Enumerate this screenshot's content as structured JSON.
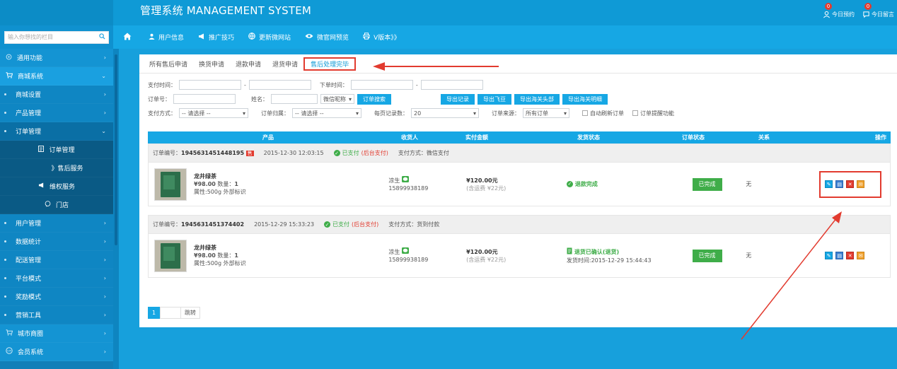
{
  "header": {
    "title": "管理系统 MANAGEMENT SYSTEM",
    "appointments": {
      "label": "今日预约",
      "count": "0",
      "icon": "user-icon"
    },
    "messages": {
      "label": "今日留言",
      "count": "0",
      "icon": "chat-bubble-icon"
    }
  },
  "navbar": {
    "items": [
      {
        "label": "用户信息",
        "icon": "user-icon"
      },
      {
        "label": "推广技巧",
        "icon": "megaphone-icon"
      },
      {
        "label": "更新微网站",
        "icon": "globe-icon"
      },
      {
        "label": "微官网预览",
        "icon": "eye-icon"
      },
      {
        "label": "V版本》》",
        "icon": "printer-icon"
      }
    ]
  },
  "sidebar": {
    "search_placeholder": "输入你想找的栏目",
    "items": [
      {
        "label": "通用功能"
      },
      {
        "label": "商城系统"
      },
      {
        "label": "商城设置"
      },
      {
        "label": "产品管理"
      },
      {
        "label": "订单管理"
      },
      {
        "label": "订单管理"
      },
      {
        "label": "》售后服务"
      },
      {
        "label": "维权服务"
      },
      {
        "label": "门店"
      },
      {
        "label": "用户管理"
      },
      {
        "label": "数据统计"
      },
      {
        "label": "配送管理"
      },
      {
        "label": "平台模式"
      },
      {
        "label": "奖励模式"
      },
      {
        "label": "营销工具"
      },
      {
        "label": "城市商圈"
      },
      {
        "label": "会员系统"
      }
    ]
  },
  "tabs": [
    "所有售后申请",
    "换货申请",
    "退款申请",
    "退货申请",
    "售后处理完毕"
  ],
  "filters": {
    "pay_time_label": "支付时间：",
    "order_time_label": "下单时间：",
    "order_no_label": "订单号：",
    "name_label": "姓名：",
    "nickname_select": "微信昵称",
    "search_btn": "订单搜索",
    "export_buttons": [
      "导出记录",
      "导出飞豆",
      "导出海关头部",
      "导出海关明细"
    ],
    "pay_method_label": "支付方式：",
    "pay_method_value": "-- 请选择 --",
    "order_group_label": "订单归属：",
    "order_group_value": "-- 请选择 --",
    "page_size_label": "每页记录数：",
    "page_size_value": "20",
    "order_source_label": "订单来源：",
    "order_source_value": "所有订单",
    "auto_refresh_label": "自动刷新订单",
    "order_alert_label": "订单提醒功能"
  },
  "table": {
    "columns": [
      "产品",
      "收货人",
      "实付金额",
      "发货状态",
      "订单状态",
      "关系",
      "操作"
    ],
    "orders": [
      {
        "order_no_label": "订单编号：",
        "order_no": "1945631451448195",
        "tag": "售",
        "time": "2015-12-30 12:03:15",
        "paid_text": "已支付",
        "paid_sub": "(后台支付)",
        "pay_method": "支付方式：微信支付",
        "product_name": "龙井绿茶",
        "product_price": "¥98.00",
        "qty_label": "数量：",
        "qty": "1",
        "attr": "属性:500g 外部标识",
        "receiver": "凉生",
        "phone": "15899938189",
        "amount": "¥120.00元",
        "freight": "(含运费 ¥22元)",
        "ship_status": "退款完成",
        "ship_time": "",
        "order_status": "已完成",
        "relation": "无"
      },
      {
        "order_no_label": "订单编号：",
        "order_no": "1945631451374402",
        "tag": "",
        "time": "2015-12-29 15:33:23",
        "paid_text": "已支付",
        "paid_sub": "(后台支付)",
        "pay_method": "支付方式：货到付款",
        "product_name": "龙井绿茶",
        "product_price": "¥98.00",
        "qty_label": "数量：",
        "qty": "1",
        "attr": "属性:500g 外部标识",
        "receiver": "凉生",
        "phone": "15899938189",
        "amount": "¥120.00元",
        "freight": "(含运费 ¥22元)",
        "ship_status": "退货已确认(退货)",
        "ship_time": "发货时间:2015-12-29 15:44:43",
        "order_status": "已完成",
        "relation": "无"
      }
    ]
  },
  "pagination": {
    "current": "1",
    "jump_label": "跳转"
  },
  "colors": {
    "primary": "#16a7e4",
    "success": "#3fad49",
    "danger": "#e23b2f",
    "warning": "#f0a12e"
  }
}
